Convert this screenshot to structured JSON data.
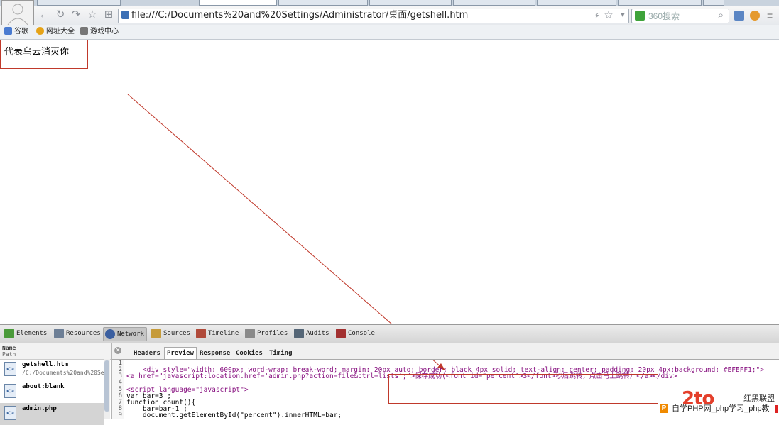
{
  "browser": {
    "url": "file:///C:/Documents%20and%20Settings/Administrator/桌面/getshell.htm",
    "search_placeholder": "360搜索"
  },
  "bookmarks": [
    {
      "label": "谷歌",
      "icon": "google-icon",
      "color": "#4a7bd0"
    },
    {
      "label": "网址大全",
      "icon": "sites-icon",
      "color": "#e6a317"
    },
    {
      "label": "游戏中心",
      "icon": "gamepad-icon",
      "color": "#777777"
    }
  ],
  "page": {
    "text": "代表乌云消灭你"
  },
  "devtools": {
    "tabs": [
      {
        "label": "Elements",
        "icon": "elements-icon",
        "color": "#4a9a3a"
      },
      {
        "label": "Resources",
        "icon": "resources-icon",
        "color": "#6d7f96"
      },
      {
        "label": "Network",
        "icon": "network-icon",
        "color": "#3b5fa0"
      },
      {
        "label": "Sources",
        "icon": "sources-icon",
        "color": "#c69b3a"
      },
      {
        "label": "Timeline",
        "icon": "timeline-icon",
        "color": "#b04a3a"
      },
      {
        "label": "Profiles",
        "icon": "profiles-icon",
        "color": "#8a8a8a"
      },
      {
        "label": "Audits",
        "icon": "audits-icon",
        "color": "#556677"
      },
      {
        "label": "Console",
        "icon": "console-icon",
        "color": "#a23030"
      }
    ],
    "left_header": {
      "name": "Name",
      "path": "Path"
    },
    "requests": [
      {
        "name": "getshell.htm",
        "path": "/C:/Documents%20and%20Se"
      },
      {
        "name": "about:blank",
        "path": ""
      },
      {
        "name": "admin.php",
        "path": ""
      }
    ],
    "subtabs": [
      "Headers",
      "Preview",
      "Response",
      "Cookies",
      "Timing"
    ],
    "line_numbers": [
      "1",
      "2",
      "3",
      "4",
      "5",
      "6",
      "7",
      "8",
      "9"
    ],
    "code_lines": [
      "",
      "    <div style=\"width: 600px; word-wrap: break-word; margin: 20px auto; border: black 4px solid; text-align: center; padding: 20px 4px;background: #EFEFF1;\">",
      "<a href=\"javascript:location.href='admin.php?action=file&ctrl=lists';\">保存成功(<font id=\"percent\">3</font>秒后跳转，点击马上跳转）</a></div>",
      "",
      "<script language=\"javascript\">",
      "var bar=3 ;",
      "function count(){",
      "    bar=bar-1 ;",
      "    document.getElementById(\"percent\").innerHTML=bar;"
    ]
  },
  "watermark": {
    "logo": "2to",
    "cn": "红黑联盟",
    "badge": "P",
    "text": "自学PHP网_php学习_php教"
  }
}
